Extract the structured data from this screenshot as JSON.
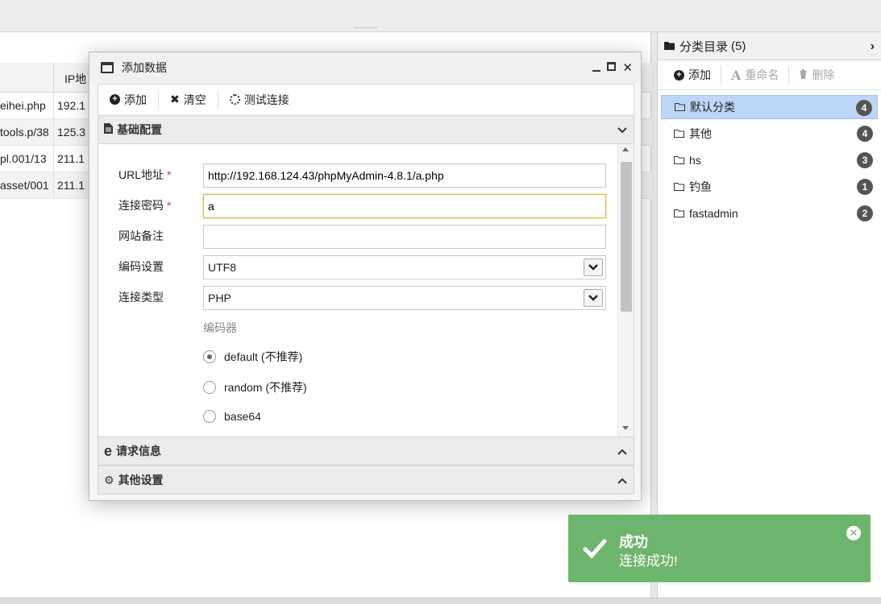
{
  "table": {
    "ip_header": "IP地",
    "rows": [
      {
        "url": "eihei.php",
        "ip": "192.1"
      },
      {
        "url": "38/tools.p",
        "ip": "125.3"
      },
      {
        "url": "001/13.pl",
        "ip": "211.1"
      },
      {
        "url": "001/asset",
        "ip": "211.1"
      }
    ]
  },
  "category_panel": {
    "title": "分类目录",
    "count": "(5)",
    "toolbar": {
      "add": "添加",
      "rename": "重命名",
      "delete": "删除"
    },
    "items": [
      {
        "name": "默认分类",
        "count": "4"
      },
      {
        "name": "其他",
        "count": "4"
      },
      {
        "name": "hs",
        "count": "3"
      },
      {
        "name": "钓鱼",
        "count": "1"
      },
      {
        "name": "fastadmin",
        "count": "2"
      }
    ]
  },
  "dialog": {
    "title": "添加数据",
    "toolbar": {
      "add": "添加",
      "clear": "清空",
      "test": "测试连接"
    },
    "sections": {
      "base": "基础配置",
      "request": "请求信息",
      "other": "其他设置"
    },
    "form": {
      "url_label": "URL地址",
      "url_value": "http://192.168.124.43/phpMyAdmin-4.8.1/a.php",
      "password_label": "连接密码",
      "password_value": "a",
      "note_label": "网站备注",
      "note_value": "",
      "encoding_label": "编码设置",
      "encoding_value": "UTF8",
      "type_label": "连接类型",
      "type_value": "PHP",
      "encoder_label": "编码器",
      "required_mark": "*",
      "encoders": [
        {
          "label": "default (不推荐)",
          "checked": true
        },
        {
          "label": "random (不推荐)",
          "checked": false
        },
        {
          "label": "base64",
          "checked": false
        }
      ]
    }
  },
  "toast": {
    "title": "成功",
    "message": "连接成功!",
    "color": "#6db56d"
  }
}
